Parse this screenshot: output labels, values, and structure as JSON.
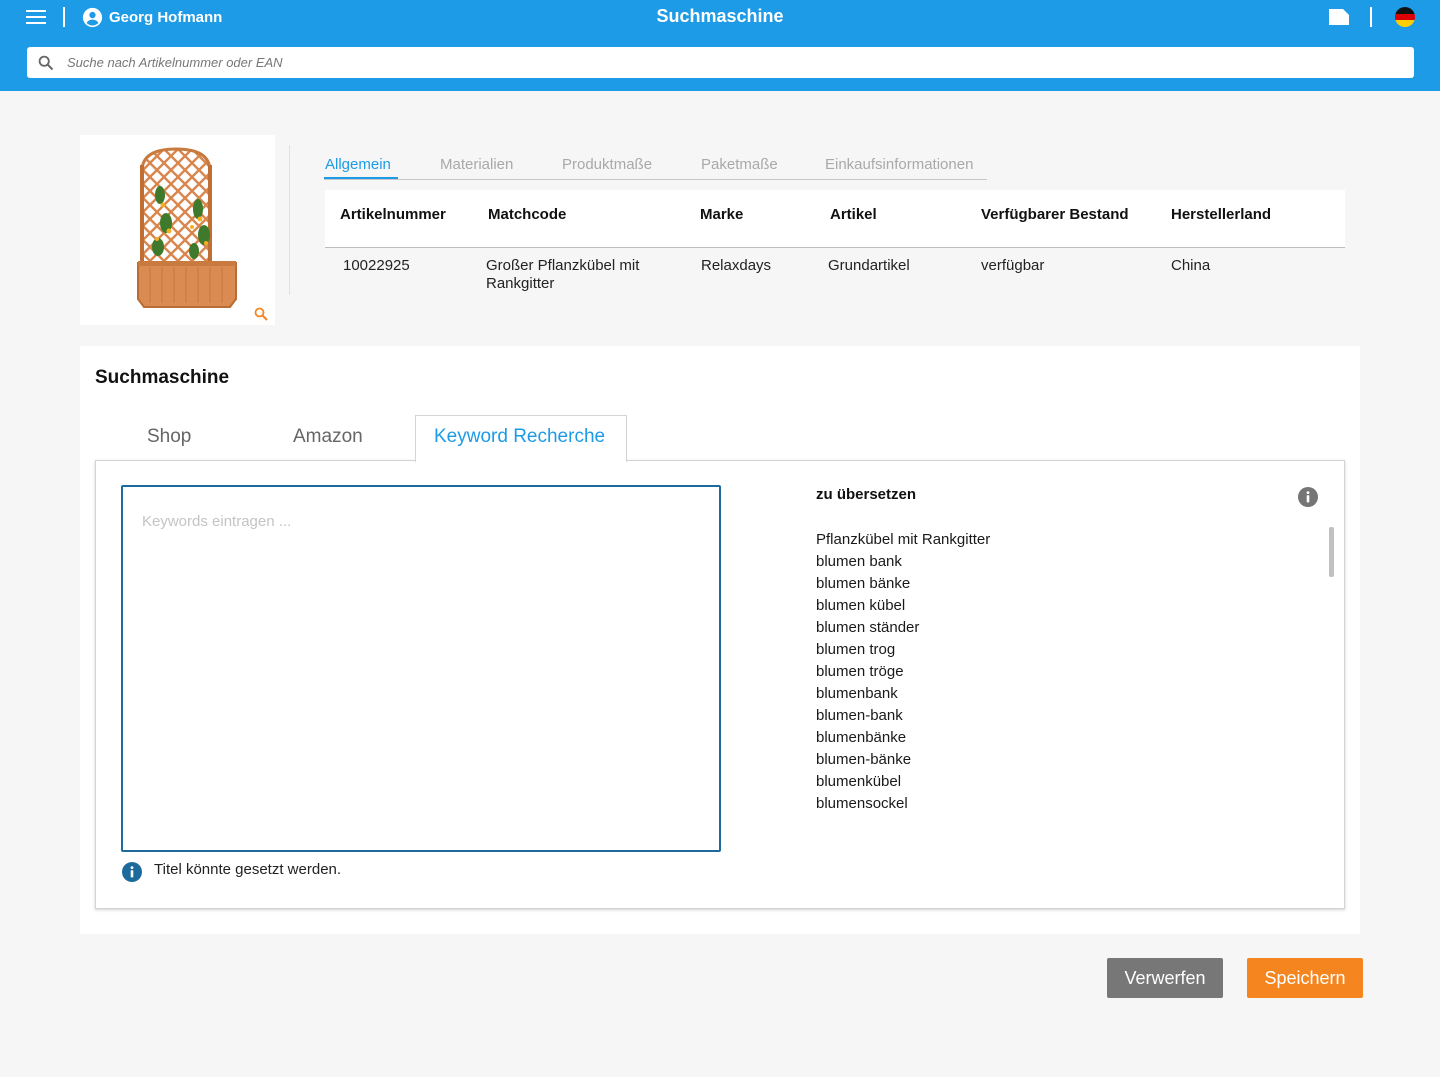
{
  "header": {
    "user_name": "Georg Hofmann",
    "app_title": "Suchmaschine",
    "brand_color": "#1e9be6",
    "icons": [
      "menu-icon",
      "user-icon",
      "file-icon",
      "german-flag-icon"
    ]
  },
  "search": {
    "placeholder": "Suche nach Artikelnummer oder EAN",
    "value": ""
  },
  "info_tabs": [
    {
      "label": "Allgemein",
      "active": true
    },
    {
      "label": "Materialien",
      "active": false
    },
    {
      "label": "Produktmaße",
      "active": false
    },
    {
      "label": "Paketmaße",
      "active": false
    },
    {
      "label": "Einkaufsinformationen",
      "active": false
    }
  ],
  "product_table": {
    "headers": [
      "Artikelnummer",
      "Matchcode",
      "Marke",
      "Artikel",
      "Verfügbarer Bestand",
      "Herstellerland"
    ],
    "row": [
      "10022925",
      "Großer Pflanzkübel mit Rankgitter",
      "Relaxdays",
      "Grundartikel",
      "verfügbar",
      "China"
    ]
  },
  "search_engine": {
    "title": "Suchmaschine",
    "tabs": [
      {
        "label": "Shop",
        "active": false
      },
      {
        "label": "Amazon",
        "active": false
      },
      {
        "label": "Keyword Recherche",
        "active": true
      }
    ],
    "keywords_placeholder": "Keywords eintragen ...",
    "keywords_value": "",
    "hint": "Titel könnte gesetzt werden.",
    "list_title": "zu übersetzen",
    "keywords": [
      "Pflanzkübel mit Rankgitter",
      "blumen bank",
      "blumen bänke",
      "blumen kübel",
      "blumen ständer",
      "blumen trog",
      "blumen tröge",
      "blumenbank",
      "blumen-bank",
      "blumenbänke",
      "blumen-bänke",
      "blumenkübel",
      "blumensockel"
    ]
  },
  "actions": {
    "discard_label": "Verwerfen",
    "save_label": "Speichern",
    "discard_color": "#777777",
    "save_color": "#f5861f"
  }
}
